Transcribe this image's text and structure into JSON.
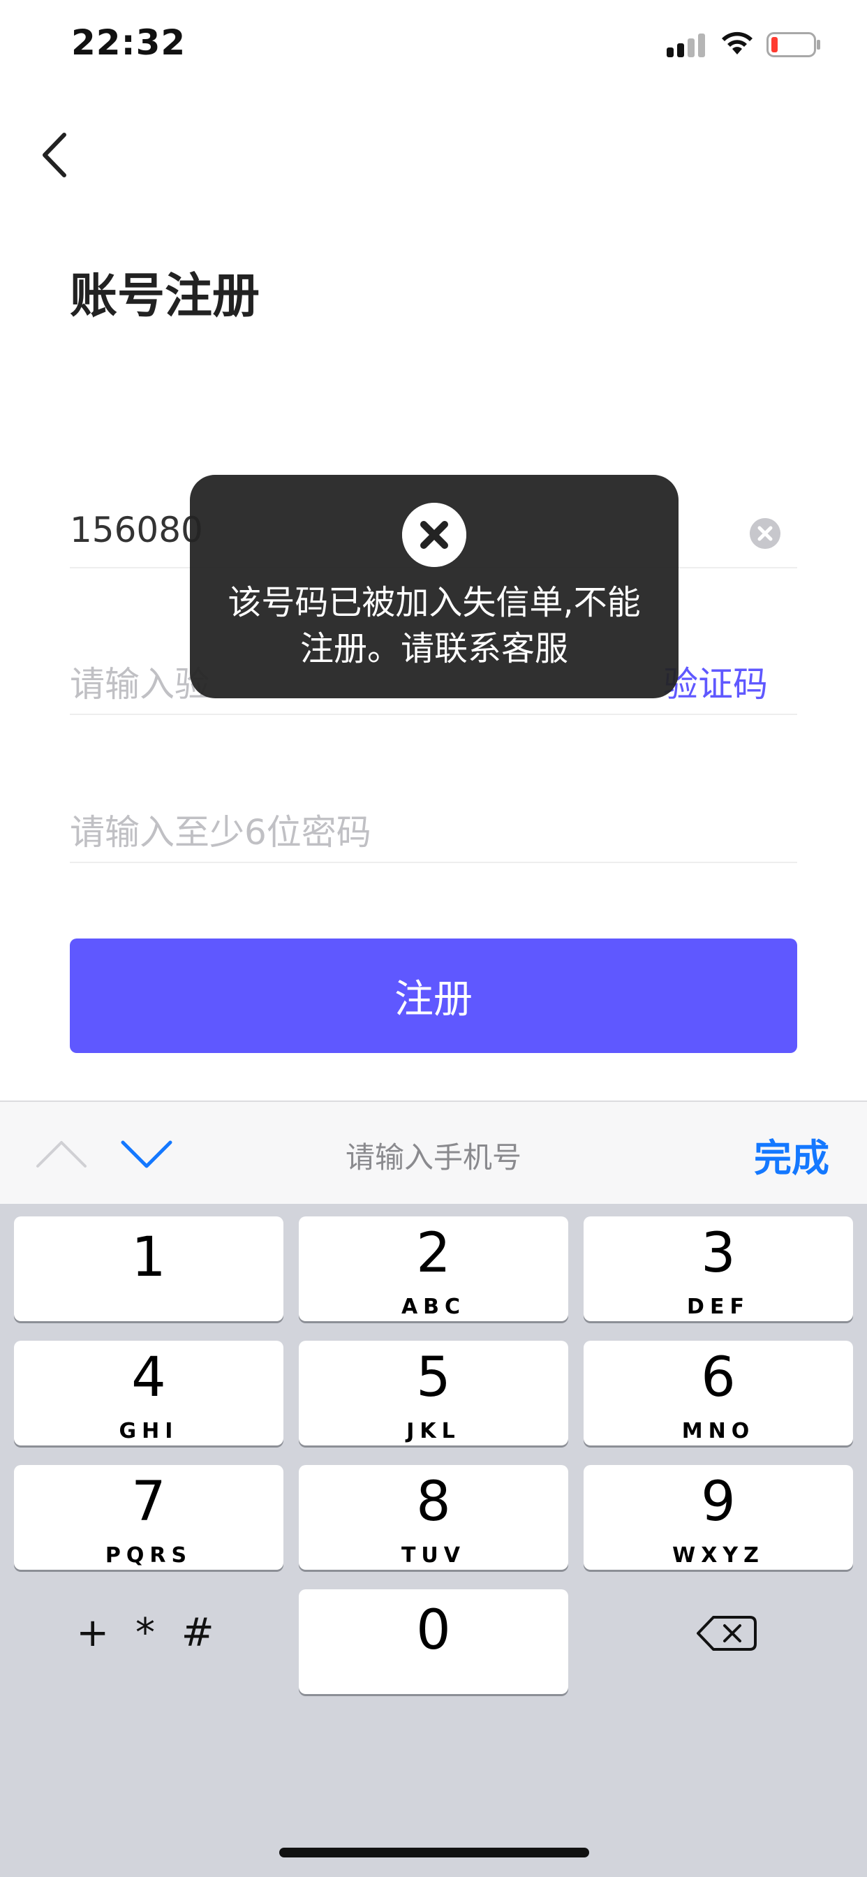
{
  "status_bar": {
    "time": "22:32"
  },
  "header": {
    "title": "账号注册"
  },
  "form": {
    "phone_value": "156080",
    "code_placeholder": "请输入验",
    "code_link": "验证码",
    "password_placeholder": "请输入至少6位密码",
    "submit_label": "注册"
  },
  "toast": {
    "message_line1": "该号码已被加入失信单,不能",
    "message_line2": "注册。请联系客服"
  },
  "keyboard": {
    "accessory_title": "请输入手机号",
    "done_label": "完成",
    "keys": [
      {
        "num": "1",
        "letters": ""
      },
      {
        "num": "2",
        "letters": "ABC"
      },
      {
        "num": "3",
        "letters": "DEF"
      },
      {
        "num": "4",
        "letters": "GHI"
      },
      {
        "num": "5",
        "letters": "JKL"
      },
      {
        "num": "6",
        "letters": "MNO"
      },
      {
        "num": "7",
        "letters": "PQRS"
      },
      {
        "num": "8",
        "letters": "TUV"
      },
      {
        "num": "9",
        "letters": "WXYZ"
      },
      {
        "num": "0",
        "letters": ""
      }
    ],
    "symbols_label": "+ * #"
  },
  "colors": {
    "accent": "#5f58ff",
    "done_blue": "#1478ff",
    "toast_bg": "#232323",
    "keypad_bg": "#d2d4db"
  }
}
